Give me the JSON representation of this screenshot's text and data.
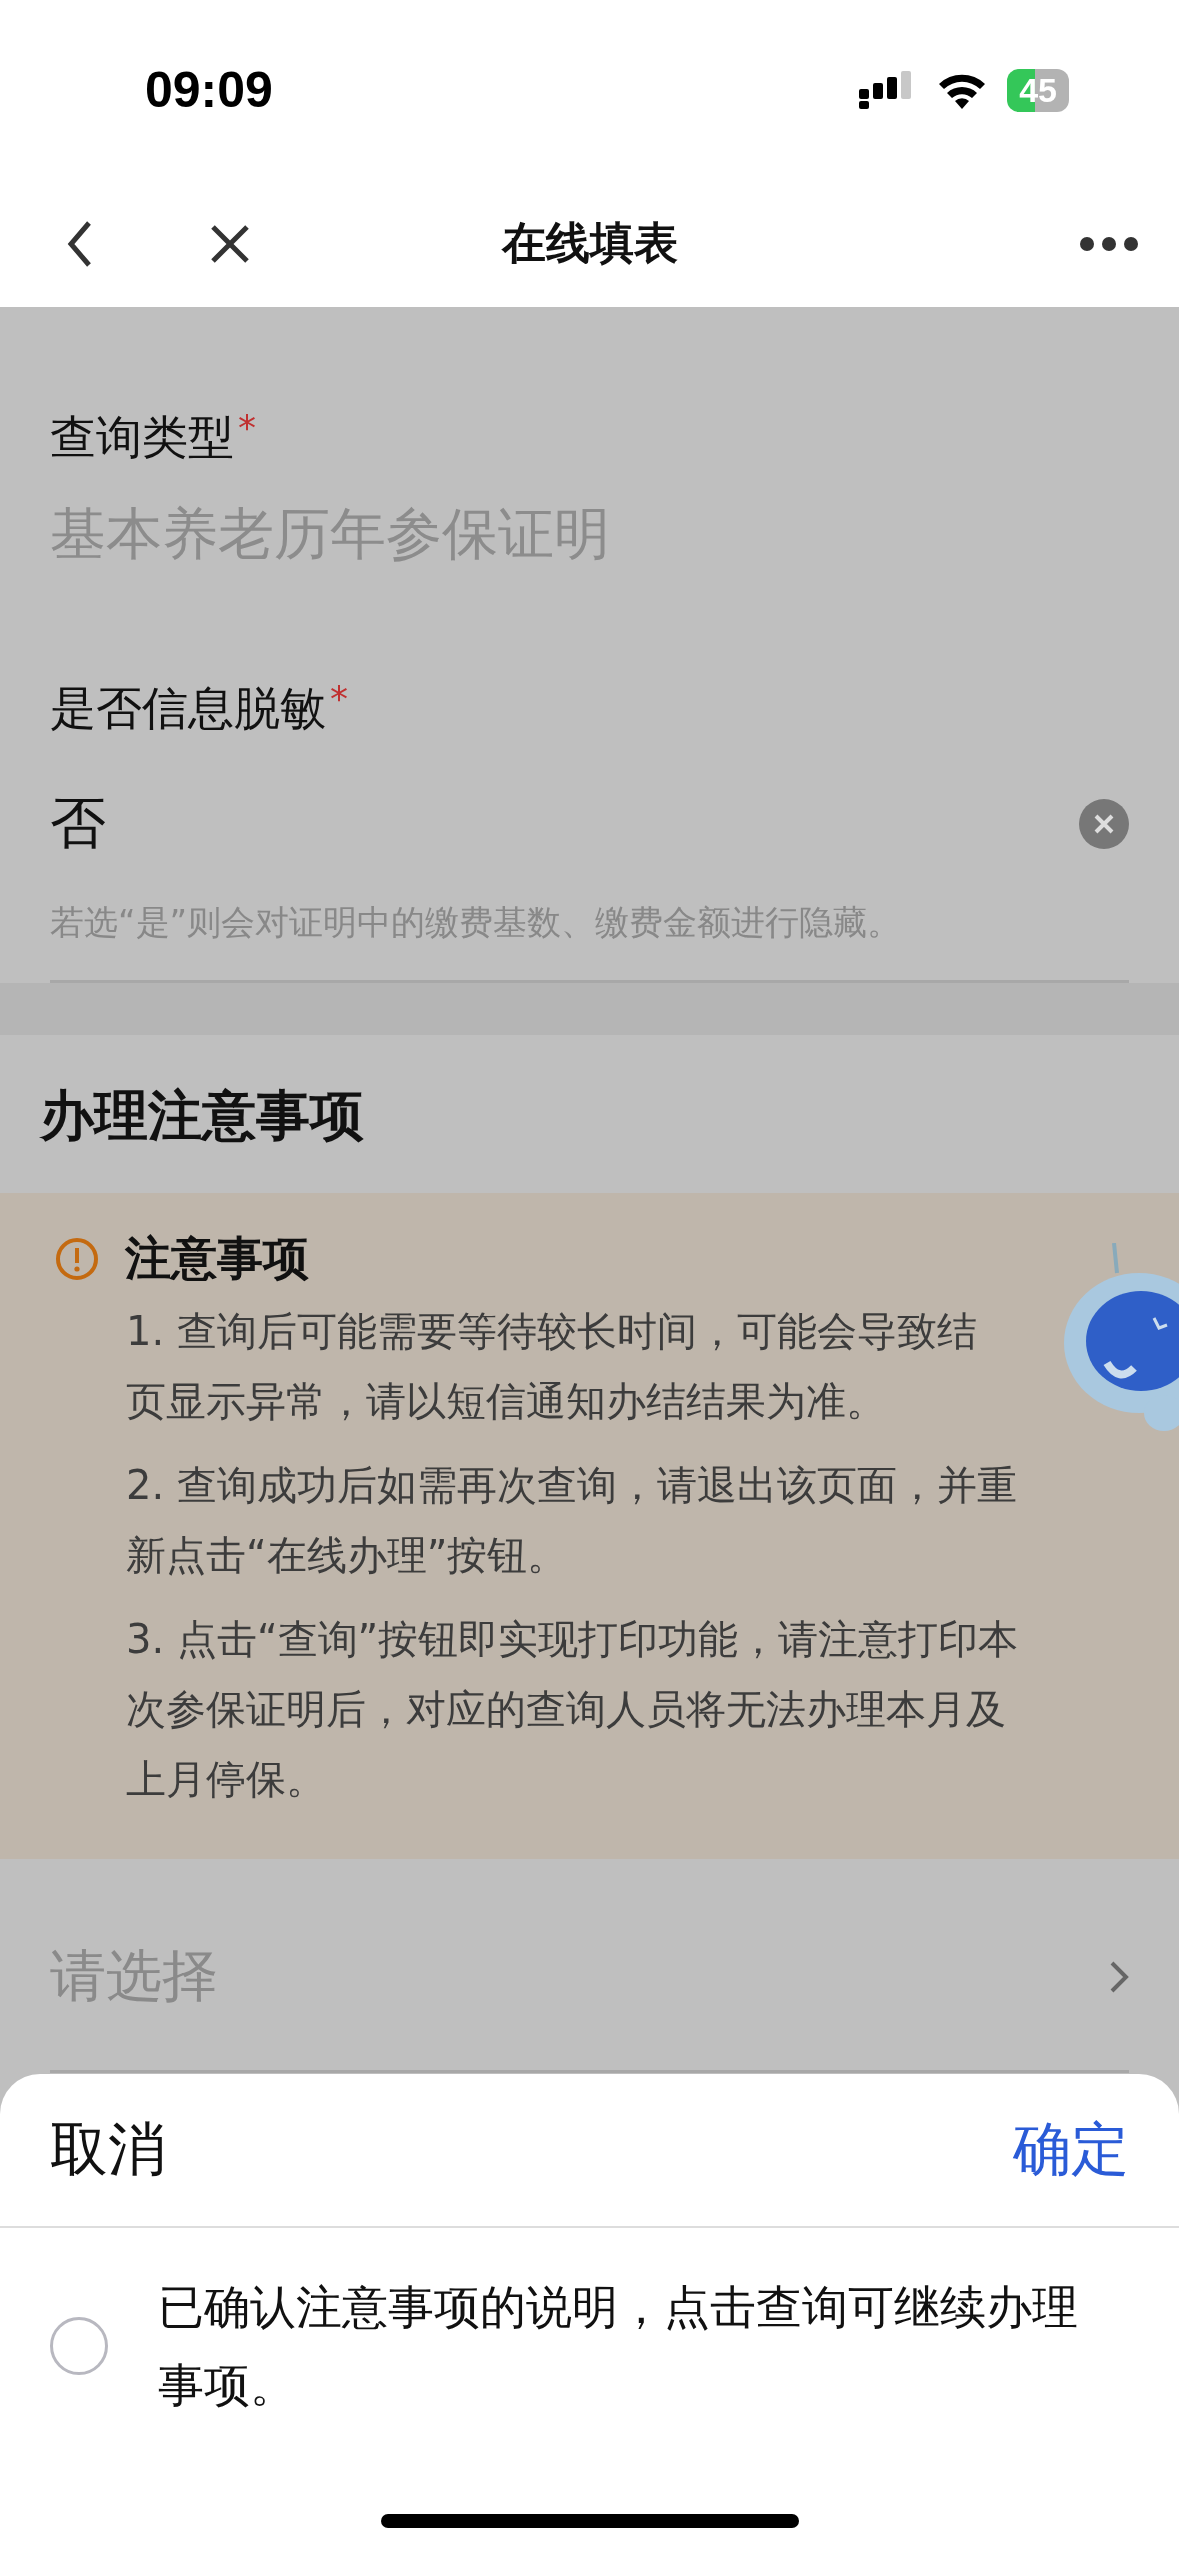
{
  "status_bar": {
    "time": "09:09",
    "battery": "45"
  },
  "nav_bar": {
    "title": "在线填表"
  },
  "form": {
    "fields": [
      {
        "kind": "select",
        "label": "查询类型",
        "required_mark": "*",
        "placeholder": "基本养老历年参保证明"
      },
      {
        "kind": "value",
        "label": "是否信息脱敏",
        "required_mark": "*",
        "value": "否",
        "clearable": true,
        "hint": "若选“是”则会对证明中的缴费基数、缴费金额进行隐藏。"
      }
    ]
  },
  "notice_section": {
    "heading": "办理注意事项",
    "card": {
      "title": "注意事项",
      "items": [
        {
          "lines": [
            "1. 查询后可能需要等待较长时间，可能会导致结",
            "页显示异常，请以短信通知办结结果为准。"
          ]
        },
        {
          "lines": [
            "2. 查询成功后如需再次查询，请退出该页面，并重",
            "新点击“在线办理”按钮。"
          ]
        },
        {
          "lines": [
            "3. 点击“查询”按钮即实现打印功能，请注意打印本",
            "次参保证明后，对应的查询人员将无法办理本月及",
            "上月停保。"
          ]
        }
      ]
    }
  },
  "select_field": {
    "placeholder": "请选择"
  },
  "bottom_sheet": {
    "cancel": "取消",
    "confirm": "确定",
    "option": {
      "label": "已确认注意事项的说明，点击查询可继续办理事项。",
      "checked": false
    }
  }
}
